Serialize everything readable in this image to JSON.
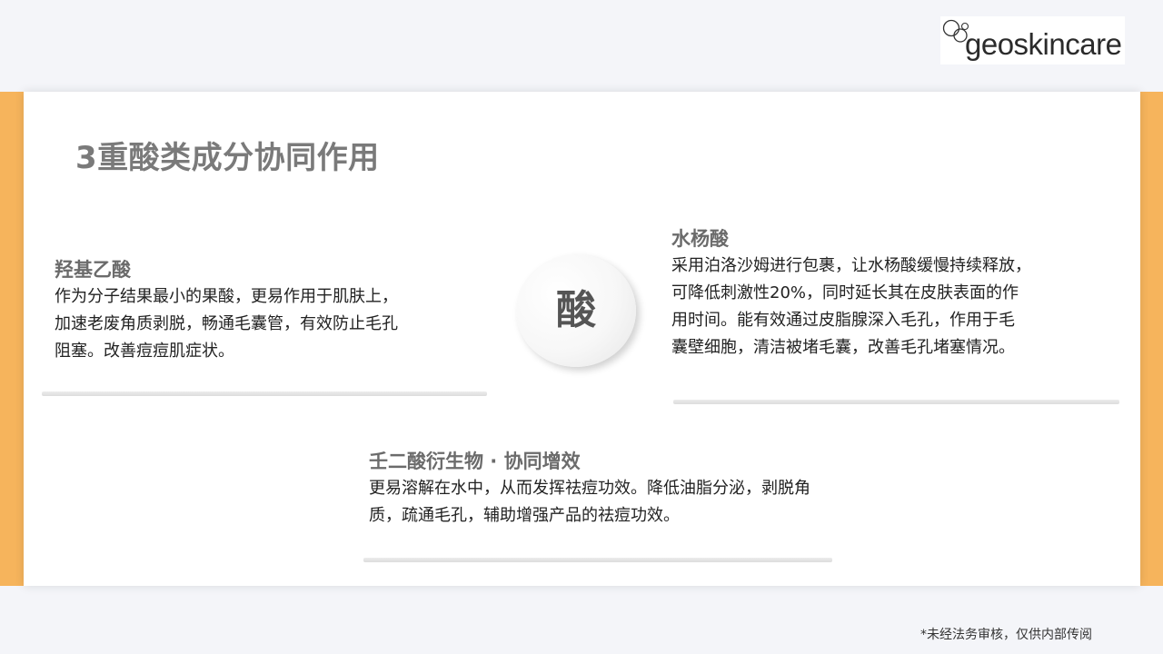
{
  "brand": {
    "logo_text": "geoskincare"
  },
  "colors": {
    "accent": "#f6b45c",
    "title": "#7a7a7a",
    "heading": "#6b6b6b"
  },
  "slide": {
    "title": "3重酸类成分协同作用",
    "center_label": "酸",
    "sections": [
      {
        "heading": "羟基乙酸",
        "lines": [
          "作为分子结果最小的果酸，更易作用于肌肤上，",
          "加速老废角质剥脱，畅通毛囊管，有效防止毛孔",
          "阻塞。改善痘痘肌症状。"
        ]
      },
      {
        "heading": "水杨酸",
        "lines": [
          "采用泊洛沙姆进行包裹，让水杨酸缓慢持续释放，",
          "可降低刺激性20%，同时延长其在皮肤表面的作",
          "用时间。能有效通过皮脂腺深入毛孔，作用于毛",
          "囊壁细胞，清洁被堵毛囊，改善毛孔堵塞情况。"
        ]
      },
      {
        "heading": "壬二酸衍生物 · 协同增效",
        "lines": [
          "更易溶解在水中，从而发挥祛痘功效。降低油脂分泌，剥脱角",
          "质，疏通毛孔，辅助增强产品的祛痘功效。"
        ]
      }
    ]
  },
  "footer": {
    "note": "*未经法务审核，仅供内部传阅"
  }
}
